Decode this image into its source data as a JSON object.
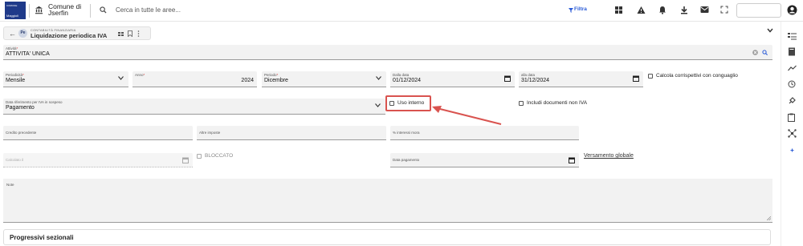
{
  "header": {
    "logo_top": "COMUNE",
    "logo_text": "Maggioli",
    "org_line1": "Comune di",
    "org_line2": "Jserfin",
    "search_placeholder": "Cerca in tutte le aree...",
    "filter_label": "Filtra"
  },
  "tab": {
    "badge": "Pe",
    "module": "CONTABILITÀ FINANZIARIA",
    "title": "Liquidazione periodica IVA"
  },
  "form": {
    "attivita": {
      "label": "Attività",
      "value": "ATTIVITA' UNICA"
    },
    "periodicita": {
      "label": "Periodicità",
      "value": "Mensile"
    },
    "anno": {
      "label": "Anno",
      "value": "2024"
    },
    "periodo": {
      "label": "Periodo",
      "value": "Dicembre"
    },
    "dalla_data": {
      "label": "Dalla data",
      "value": "01/12/2024"
    },
    "alla_data": {
      "label": "alla data",
      "value": "31/12/2024"
    },
    "calcola_corrispettivi": "Calcola corrispettivi con conguaglio",
    "data_riferimento": {
      "label": "Data riferimento per IVA in sospeso",
      "value": "Pagamento"
    },
    "uso_interno": "Uso interno",
    "includi_documenti": "Includi documenti non IVA",
    "credito_precedente": "Credito precedente",
    "altre_imposte": "Altre imposte",
    "interessi_mora": "% interessi mora",
    "calcolato_il": "Calcolato il",
    "bloccato": "BLOCCATO",
    "data_pagamento": "Data pagamento",
    "versamento_globale": "Versamento globale",
    "note": "Note"
  },
  "section": {
    "title": "Progressivi sezionali"
  },
  "colors": {
    "accent": "#2a5bd7",
    "highlight": "#d9534f",
    "required": "#d32f2f"
  }
}
